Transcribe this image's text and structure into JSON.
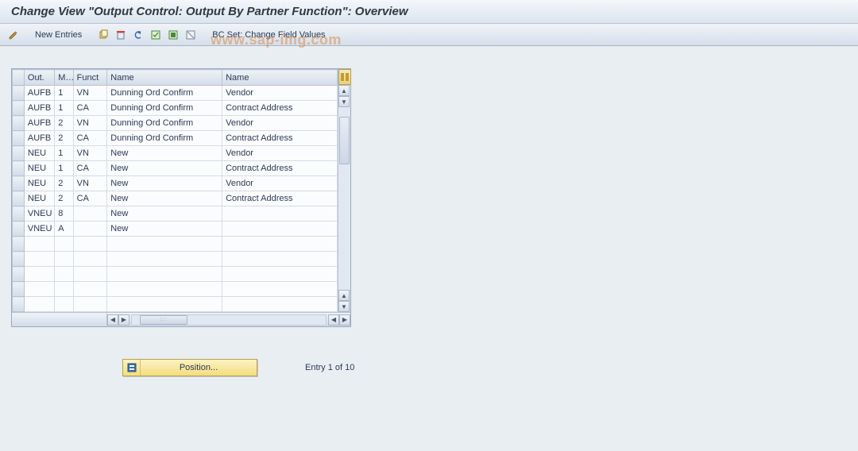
{
  "title": "Change View \"Output Control: Output By Partner Function\": Overview",
  "toolbar": {
    "new_entries": "New Entries",
    "bc_set": "BC Set: Change Field Values"
  },
  "watermark": "www.sap-img.com",
  "grid": {
    "headers": [
      "Out.",
      "M...",
      "Funct",
      "Name",
      "Name"
    ],
    "rows": [
      {
        "out": "AUFB",
        "m": "1",
        "funct": "VN",
        "name1": "Dunning Ord Confirm",
        "name2": "Vendor"
      },
      {
        "out": "AUFB",
        "m": "1",
        "funct": "CA",
        "name1": "Dunning Ord Confirm",
        "name2": "Contract Address"
      },
      {
        "out": "AUFB",
        "m": "2",
        "funct": "VN",
        "name1": "Dunning Ord Confirm",
        "name2": "Vendor"
      },
      {
        "out": "AUFB",
        "m": "2",
        "funct": "CA",
        "name1": "Dunning Ord Confirm",
        "name2": "Contract Address"
      },
      {
        "out": "NEU",
        "m": "1",
        "funct": "VN",
        "name1": "New",
        "name2": "Vendor"
      },
      {
        "out": "NEU",
        "m": "1",
        "funct": "CA",
        "name1": "New",
        "name2": "Contract Address"
      },
      {
        "out": "NEU",
        "m": "2",
        "funct": "VN",
        "name1": "New",
        "name2": "Vendor"
      },
      {
        "out": "NEU",
        "m": "2",
        "funct": "CA",
        "name1": "New",
        "name2": "Contract Address"
      },
      {
        "out": "VNEU",
        "m": "8",
        "funct": "",
        "name1": "New",
        "name2": ""
      },
      {
        "out": "VNEU",
        "m": "A",
        "funct": "",
        "name1": "New",
        "name2": ""
      },
      {
        "out": "",
        "m": "",
        "funct": "",
        "name1": "",
        "name2": ""
      },
      {
        "out": "",
        "m": "",
        "funct": "",
        "name1": "",
        "name2": ""
      },
      {
        "out": "",
        "m": "",
        "funct": "",
        "name1": "",
        "name2": ""
      },
      {
        "out": "",
        "m": "",
        "funct": "",
        "name1": "",
        "name2": ""
      },
      {
        "out": "",
        "m": "",
        "funct": "",
        "name1": "",
        "name2": ""
      }
    ]
  },
  "footer": {
    "position_label": "Position...",
    "entry_text": "Entry 1 of 10"
  }
}
